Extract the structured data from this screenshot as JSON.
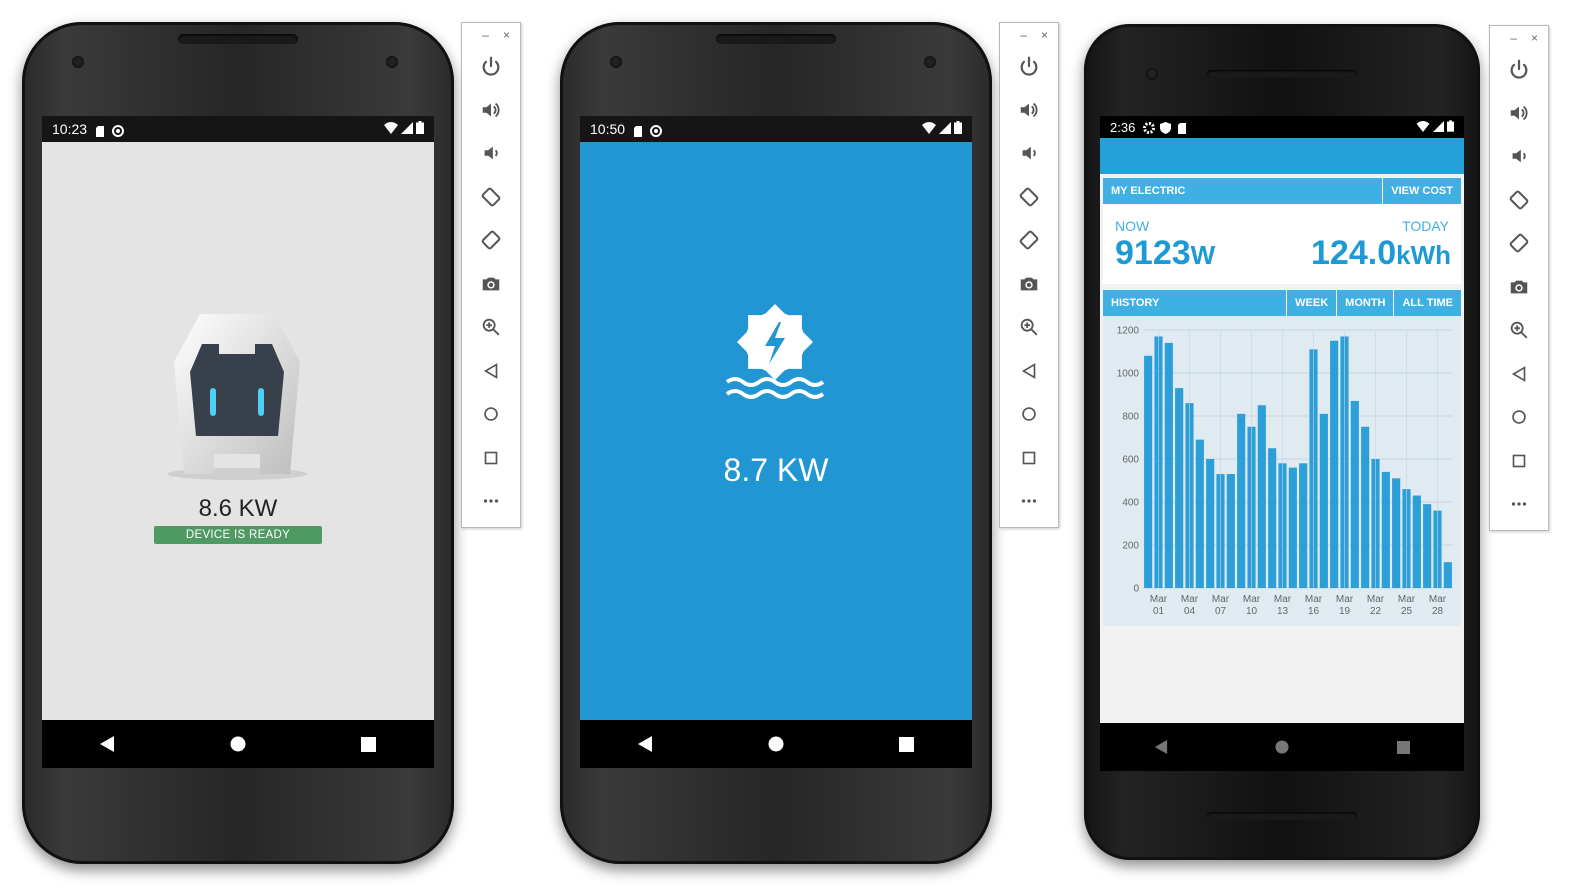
{
  "phone1": {
    "status_time": "10:23",
    "power_reading": "8.6 KW",
    "device_status": "DEVICE IS READY"
  },
  "phone2": {
    "status_time": "10:50",
    "power_reading": "8.7 KW"
  },
  "phone3": {
    "status_time": "2:36",
    "my_electric_label": "MY ELECTRIC",
    "view_cost_label": "VIEW COST",
    "now_label": "NOW",
    "now_value": "9123",
    "now_unit": "W",
    "today_label": "TODAY",
    "today_value": "124.0",
    "today_unit": "kWh",
    "history_label": "HISTORY",
    "tabs": [
      "WEEK",
      "MONTH",
      "ALL TIME"
    ]
  },
  "emulator_toolbar": {
    "minimize": "–",
    "close": "×",
    "items": [
      "power-icon",
      "volume-up-icon",
      "volume-down-icon",
      "rotate-left-icon",
      "rotate-right-icon",
      "camera-icon",
      "zoom-icon",
      "back-icon",
      "home-icon",
      "overview-icon",
      "more-icon"
    ]
  },
  "colors": {
    "accent_blue": "#2196d3",
    "chart_bar": "#2d9fd8",
    "ready_green": "#4f9a63"
  },
  "chart_data": {
    "type": "bar",
    "ylim": [
      0,
      1200
    ],
    "yticks": [
      0,
      200,
      400,
      600,
      800,
      1000,
      1200
    ],
    "tick_labels": [
      [
        "Mar",
        "01"
      ],
      [
        "Mar",
        "04"
      ],
      [
        "Mar",
        "07"
      ],
      [
        "Mar",
        "10"
      ],
      [
        "Mar",
        "13"
      ],
      [
        "Mar",
        "16"
      ],
      [
        "Mar",
        "19"
      ],
      [
        "Mar",
        "22"
      ],
      [
        "Mar",
        "25"
      ],
      [
        "Mar",
        "28"
      ]
    ],
    "x_start_day": 1,
    "values": [
      1080,
      1170,
      1140,
      930,
      860,
      690,
      600,
      530,
      530,
      810,
      750,
      850,
      650,
      580,
      560,
      580,
      1110,
      810,
      1150,
      1170,
      870,
      750,
      600,
      540,
      510,
      460,
      430,
      390,
      360,
      120
    ]
  }
}
